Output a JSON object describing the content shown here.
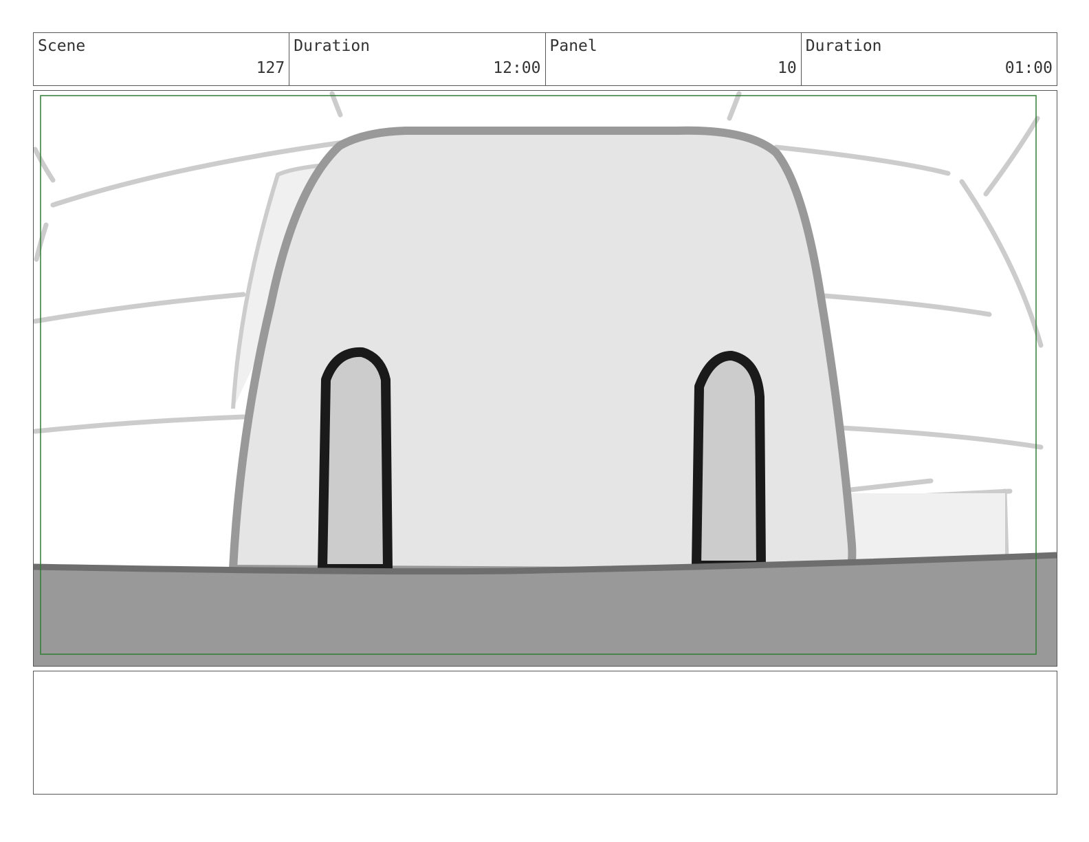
{
  "header": {
    "scene_label": "Scene",
    "scene_value": "127",
    "scene_duration_label": "Duration",
    "scene_duration_value": "12:00",
    "panel_label": "Panel",
    "panel_value": "10",
    "panel_duration_label": "Duration",
    "panel_duration_value": "01:00"
  },
  "colors": {
    "frame_guide": "#2e7d32",
    "sketch_light": "#cccccc",
    "sketch_mid": "#999999",
    "sketch_dark": "#1a1a1a",
    "ground": "#999999"
  },
  "notes": {
    "text": ""
  }
}
